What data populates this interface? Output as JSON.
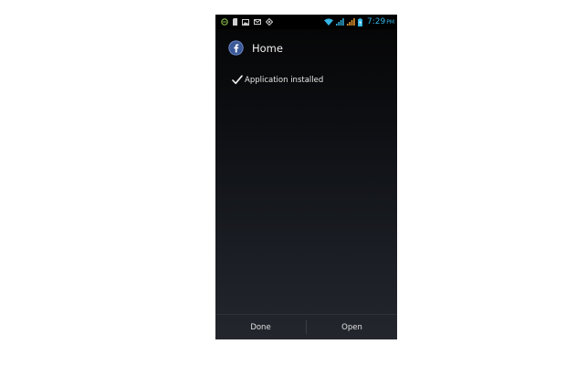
{
  "status_bar": {
    "left_icons": [
      "android-debug-icon",
      "sd-card-icon",
      "image-icon",
      "mail-icon",
      "layers-icon"
    ],
    "right_icons": [
      "wifi-icon",
      "signal-icon",
      "signal-roaming-icon",
      "battery-charging-icon"
    ],
    "time": "7:29",
    "ampm": "PM",
    "accent_color": "#33b5e5"
  },
  "header": {
    "title": "Home",
    "app_icon": "facebook-icon",
    "app_icon_color": "#3b5998"
  },
  "install_status": {
    "icon": "check-icon",
    "message": "Application installed"
  },
  "buttons": {
    "done_label": "Done",
    "open_label": "Open"
  }
}
